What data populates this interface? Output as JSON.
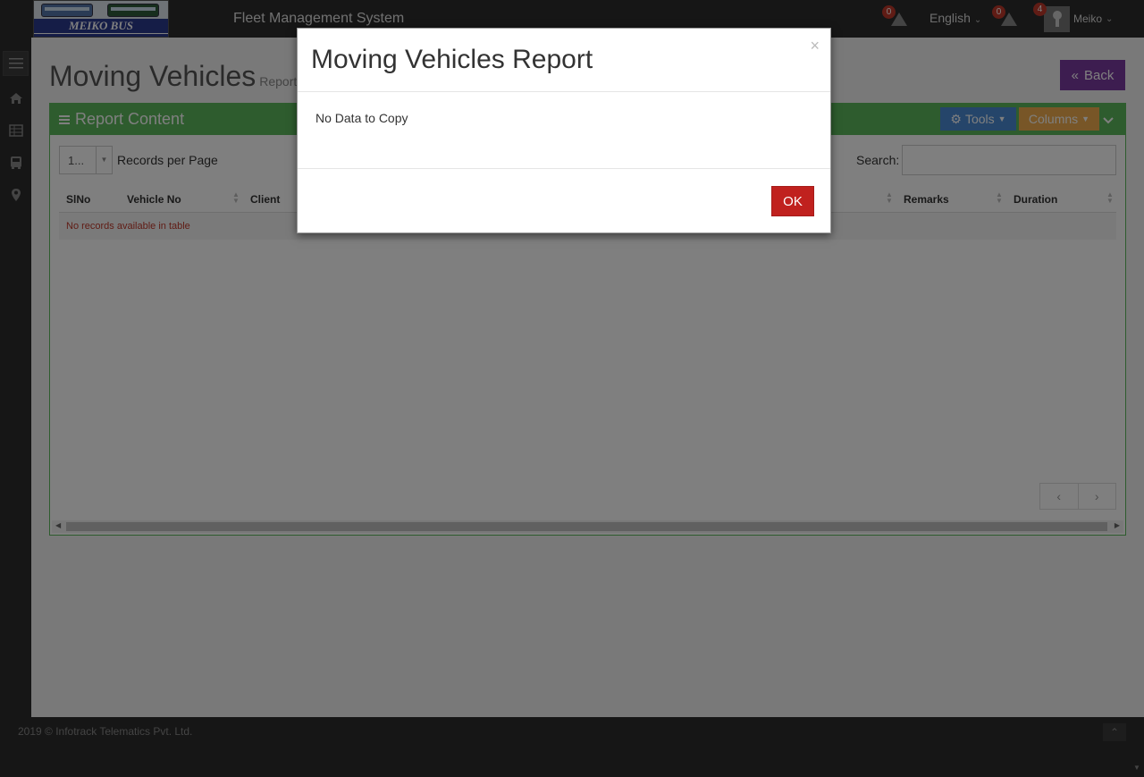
{
  "header": {
    "logo_text": "MEIKO BUS",
    "app_title": "Fleet Management System",
    "alerts_count_1": "0",
    "language": "English",
    "alerts_count_2": "0",
    "user_badge": "4",
    "user_name": "Meiko"
  },
  "sidebar": {
    "items": [
      "menu-icon",
      "home-icon",
      "table-icon",
      "bus-icon",
      "map-marker-icon"
    ]
  },
  "page": {
    "title": "Moving Vehicles",
    "subtitle": "Report",
    "back_label": "Back"
  },
  "panel": {
    "title": "Report Content",
    "tools_label": "Tools",
    "columns_label": "Columns",
    "per_page_value": "1...",
    "per_page_label": "Records per Page",
    "search_label": "Search:",
    "search_value": "",
    "columns": [
      "SlNo",
      "Vehicle No",
      "Client",
      "Remarks",
      "Duration"
    ],
    "empty_text": "No records available in table",
    "pager_prev": "‹",
    "pager_next": "›"
  },
  "footer": {
    "copyright": "2019 © Infotrack Telematics Pvt. Ltd."
  },
  "modal": {
    "title": "Moving Vehicles Report",
    "message": "No Data to Copy",
    "ok_label": "OK",
    "close_label": "×"
  },
  "colors": {
    "panel_green": "#5cb85c",
    "back_purple": "#7b3aa0",
    "tools_blue": "#4a8ad4",
    "columns_orange": "#f0ad4e",
    "ok_red": "#c0211e",
    "badge_red": "#c0392b"
  }
}
